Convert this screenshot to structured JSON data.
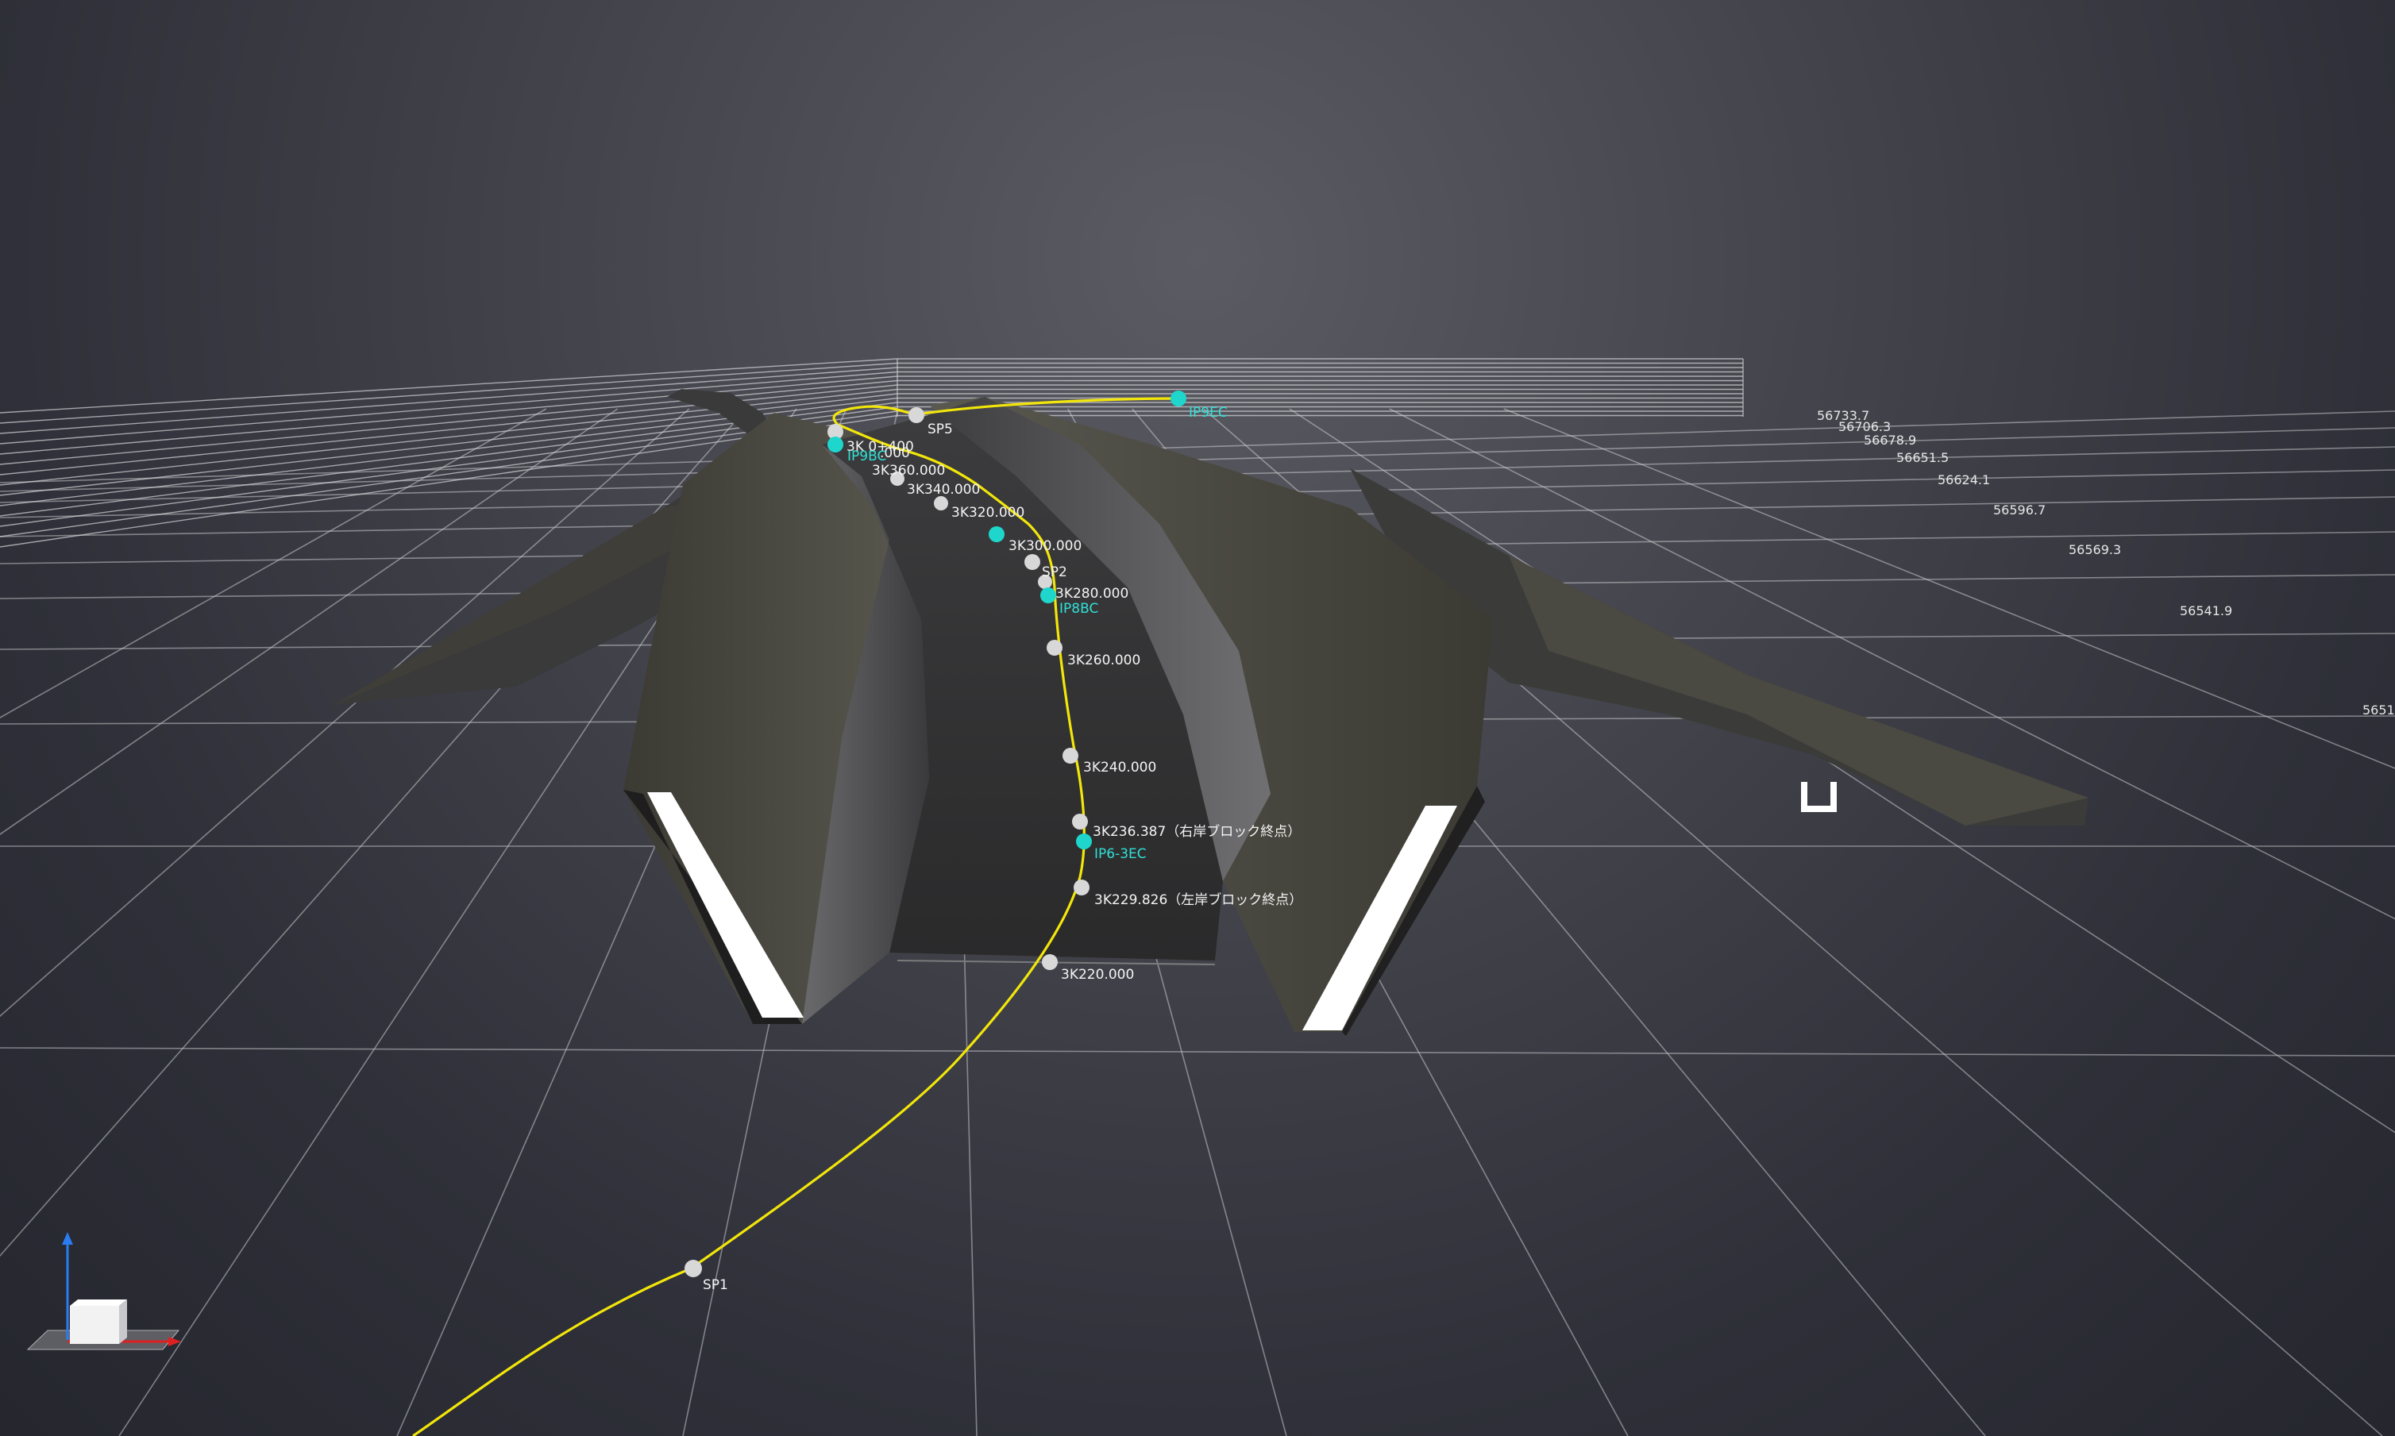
{
  "station_labels": [
    {
      "text": "3K 0+400"
    },
    {
      "text": "3K360.000"
    },
    {
      "text": "3K340.000"
    },
    {
      "text": "3K320.000"
    },
    {
      "text": "3K300.000"
    },
    {
      "text": "3K280.000"
    },
    {
      "text": "3K260.000"
    },
    {
      "text": "3K240.000"
    },
    {
      "text": "3K236.387（右岸ブロック終点）"
    },
    {
      "text": "3K229.826（左岸ブロック終点）"
    },
    {
      "text": "3K220.000"
    },
    {
      "text": ".000"
    }
  ],
  "sp_labels": [
    {
      "text": "SP5"
    },
    {
      "text": "SP2"
    },
    {
      "text": "SP1"
    }
  ],
  "ip_labels": [
    {
      "text": "IP9EC"
    },
    {
      "text": "IP9BC"
    },
    {
      "text": "IP8BC"
    },
    {
      "text": "IP6-3EC"
    }
  ],
  "grid_scale_labels": [
    {
      "text": "56733.7"
    },
    {
      "text": "56706.3"
    },
    {
      "text": "56678.9"
    },
    {
      "text": "56651.5"
    },
    {
      "text": "56624.1"
    },
    {
      "text": "56596.7"
    },
    {
      "text": "56569.3"
    },
    {
      "text": "56541.9"
    },
    {
      "text": "5651"
    }
  ],
  "colors": {
    "alignment_line": "#f2e60a",
    "ip_point": "#1fd6cc",
    "station_point": "#d8d8d8",
    "grid_line": "#c8c8cc",
    "axis_x": "#e02020",
    "axis_y": "#20b020",
    "axis_z": "#2a7cf0"
  },
  "view_cube": {
    "icon": "axis-triad-icon"
  }
}
